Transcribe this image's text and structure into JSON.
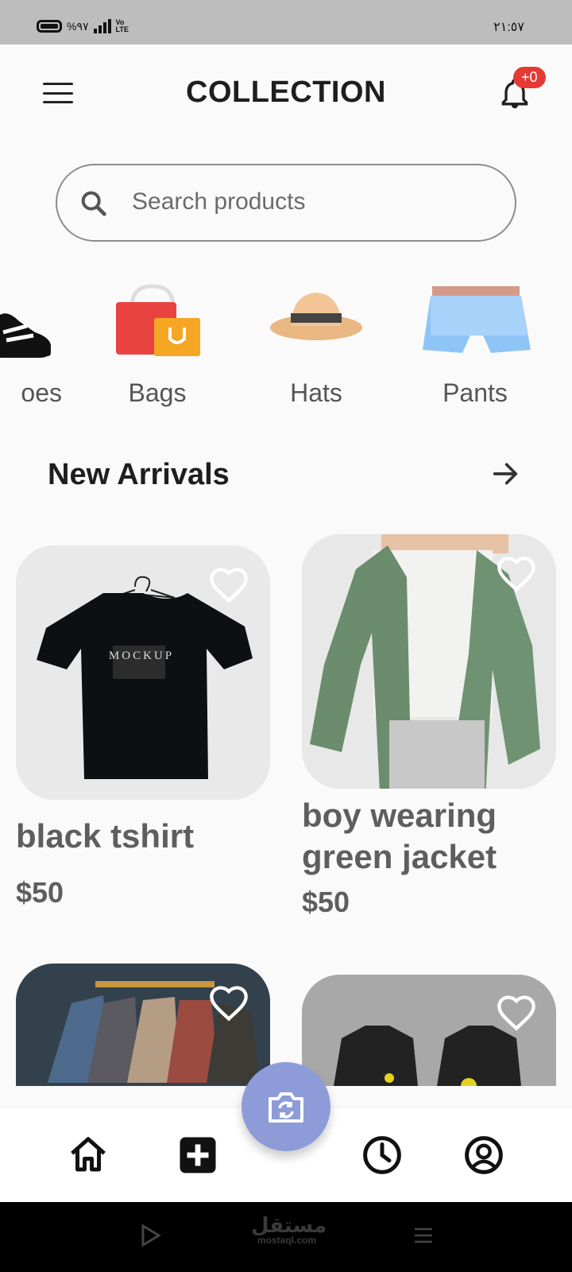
{
  "status_bar": {
    "battery_pct": "%٩٧",
    "network": "Vo LTE",
    "time": "٢١:٥٧"
  },
  "header": {
    "title": "COLLECTION",
    "notification_badge": "+0",
    "menu_icon": "hamburger-menu-icon",
    "bell_icon": "bell-icon"
  },
  "search": {
    "placeholder": "Search products",
    "value": ""
  },
  "categories": [
    {
      "label": "oes",
      "icon": "shoes-icon"
    },
    {
      "label": "Bags",
      "icon": "bags-icon"
    },
    {
      "label": "Hats",
      "icon": "hat-icon"
    },
    {
      "label": "Pants",
      "icon": "pants-icon"
    }
  ],
  "new_arrivals": {
    "title": "New Arrivals",
    "products": [
      {
        "name": "black tshirt",
        "price": "$50",
        "image_text": "MOCKUP"
      },
      {
        "name": "boy wearing green jacket",
        "price": "$50"
      },
      {
        "name": "",
        "price": ""
      },
      {
        "name": "",
        "price": ""
      }
    ]
  },
  "bottom_nav": {
    "items": [
      "home-icon",
      "add-icon",
      "camera-switch-icon",
      "history-icon",
      "profile-icon"
    ]
  },
  "watermark": {
    "text": "مستقل",
    "sub": "mostaql.com"
  },
  "colors": {
    "accent": "#8e9bd9",
    "badge": "#e53935",
    "status_bar": "#bdbdbd"
  }
}
